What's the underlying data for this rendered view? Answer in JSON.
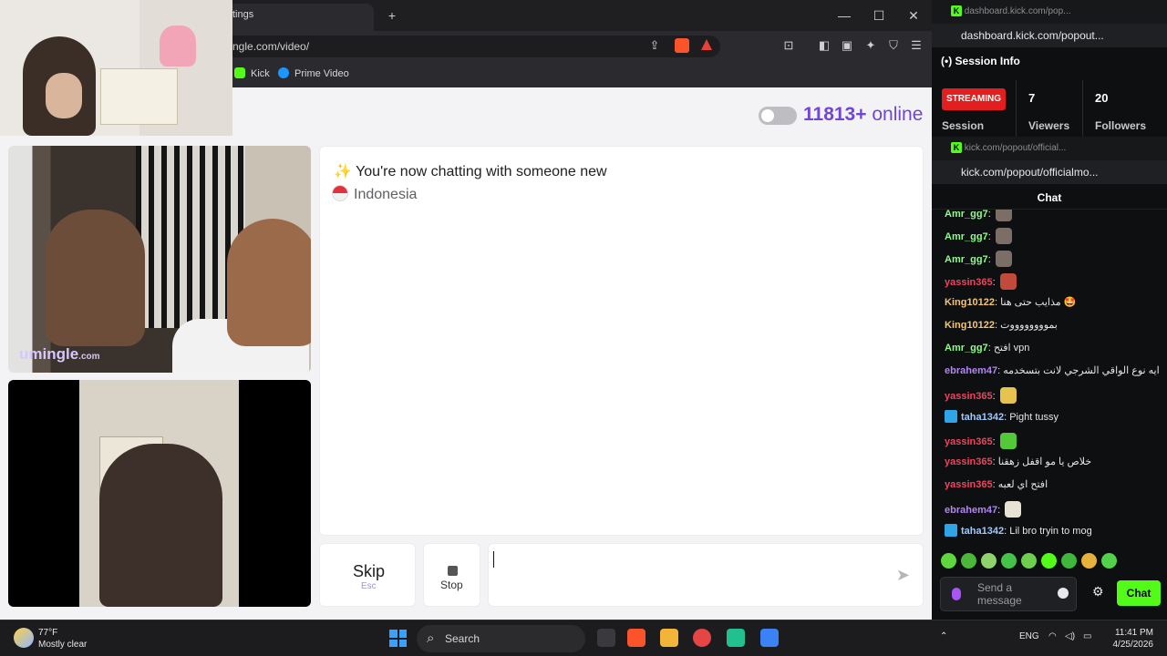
{
  "browser": {
    "tab_title": "tings",
    "url": "ngle.com/video/",
    "bookmarks": [
      {
        "label": "Kick",
        "color": "#53fc18"
      },
      {
        "label": "Prime Video",
        "color": "#1a98ff"
      }
    ],
    "window_controls": {
      "minimize": "—",
      "maximize": "☐",
      "close": "✕"
    },
    "new_tab": "+"
  },
  "page": {
    "online_count": "11813+",
    "online_label": "online",
    "watermark_brand": "umingle",
    "watermark_tld": ".com",
    "system_message": "You're now chatting with someone new",
    "sparkle_icon": "✨",
    "partner_country": "Indonesia",
    "skip_label": "Skip",
    "skip_key": "Esc",
    "stop_label": "Stop",
    "send_icon": "➤"
  },
  "session": {
    "window_title": "dashboard.kick.com/pop...",
    "url": "dashboard.kick.com/popout...",
    "heading": "Session Info",
    "status_badge": "STREAMING",
    "session_label": "Session",
    "viewers_value": "7",
    "viewers_label": "Viewers",
    "followers_value": "20",
    "followers_label": "Followers"
  },
  "kick_chat": {
    "window_title": "kick.com/popout/official...",
    "url": "kick.com/popout/officialmo...",
    "title": "Chat",
    "messages": [
      {
        "user": "Amr_gg7",
        "color": "#8dfc8a",
        "text": "",
        "emote": "#7a6e66"
      },
      {
        "user": "Amr_gg7",
        "color": "#8dfc8a",
        "text": "",
        "emote": "#7a6e66"
      },
      {
        "user": "Amr_gg7",
        "color": "#8dfc8a",
        "text": "",
        "emote": "#7a6e66"
      },
      {
        "user": "yassin365",
        "color": "#f0435f",
        "text": "",
        "emote": "#c24a3a"
      },
      {
        "user": "King10122",
        "color": "#f5c572",
        "text": "مذايب حتى هنا 🤩"
      },
      {
        "user": "King10122",
        "color": "#f5c572",
        "text": "بمووووووووت"
      },
      {
        "user": "Amr_gg7",
        "color": "#8dfc8a",
        "text": "افتح vpn"
      },
      {
        "user": "ebrahem47",
        "color": "#b186f0",
        "text": "ايه نوع الواقي الشرجي لانت بتسخدمه"
      },
      {
        "user": "yassin365",
        "color": "#f0435f",
        "text": "",
        "emote": "#e5c34c"
      },
      {
        "user": "taha1342",
        "color": "#9ec9ff",
        "text": "Pight tussy",
        "bot": true
      },
      {
        "user": "yassin365",
        "color": "#f0435f",
        "text": "",
        "emote": "#53c93a"
      },
      {
        "user": "yassin365",
        "color": "#f0435f",
        "text": "خلاص يا مو اقفل زهقنا"
      },
      {
        "user": "yassin365",
        "color": "#f0435f",
        "text": "افتح اي لعبه"
      },
      {
        "user": "ebrahem47",
        "color": "#b186f0",
        "text": "",
        "emote": "#e8e2d4"
      },
      {
        "user": "taha1342",
        "color": "#9ec9ff",
        "text": "Lil bro tryin to mog",
        "bot": true
      }
    ],
    "send_placeholder": "Send a message",
    "chat_button": "Chat",
    "gear_icon": "⚙"
  },
  "taskbar": {
    "temperature": "77°F",
    "weather": "Mostly clear",
    "search": "Search",
    "language": "ENG",
    "time": "11:41 PM",
    "date": "4/25/2026"
  }
}
